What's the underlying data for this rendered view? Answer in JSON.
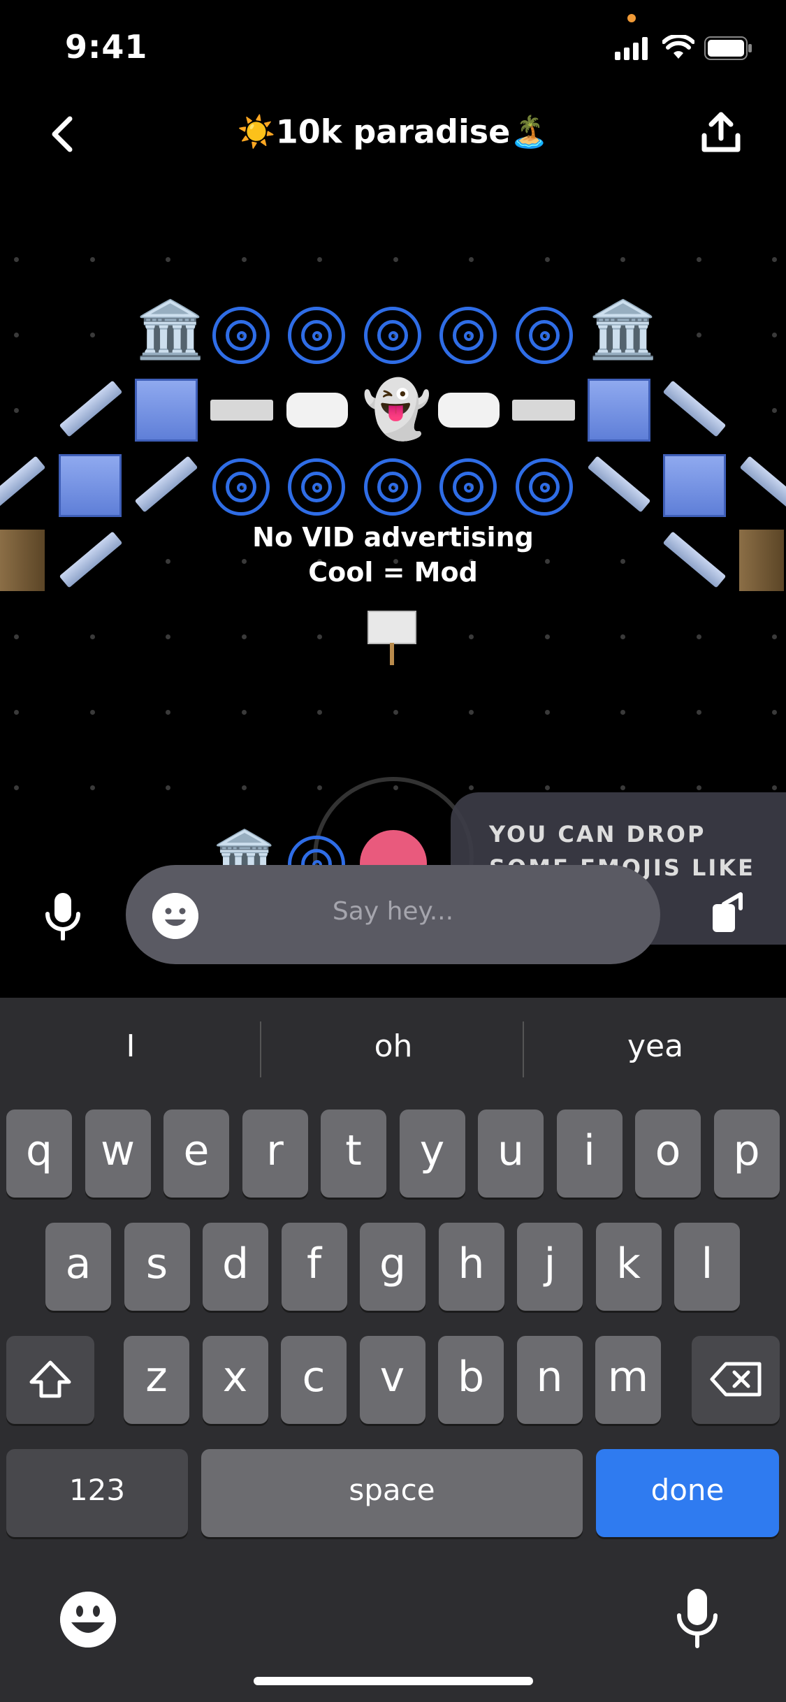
{
  "status_bar": {
    "time": "9:41"
  },
  "header": {
    "title": "10k paradise",
    "title_prefix_emoji": "☀️",
    "title_suffix_emoji": "🏝️",
    "back_icon": "chevron-left-icon",
    "share_icon": "share-icon"
  },
  "world": {
    "sign_text_line1": "No VID advertising",
    "sign_text_line2": "Cool = Mod",
    "building_emoji": "🏛️",
    "ghost_emoji": "👻"
  },
  "tooltip": {
    "text": "YOU CAN DROP SOME EMOJIS LIKE THIS"
  },
  "input": {
    "placeholder": "Say hey..."
  },
  "keyboard": {
    "suggestions": [
      "I",
      "oh",
      "yea"
    ],
    "row1": [
      "q",
      "w",
      "e",
      "r",
      "t",
      "y",
      "u",
      "i",
      "o",
      "p"
    ],
    "row2": [
      "a",
      "s",
      "d",
      "f",
      "g",
      "h",
      "j",
      "k",
      "l"
    ],
    "row3": [
      "z",
      "x",
      "c",
      "v",
      "b",
      "n",
      "m"
    ],
    "numbers_label": "123",
    "space_label": "space",
    "done_label": "done"
  },
  "colors": {
    "accent": "#2f7bf0",
    "spiral": "#2f6de6",
    "background": "#000000"
  }
}
